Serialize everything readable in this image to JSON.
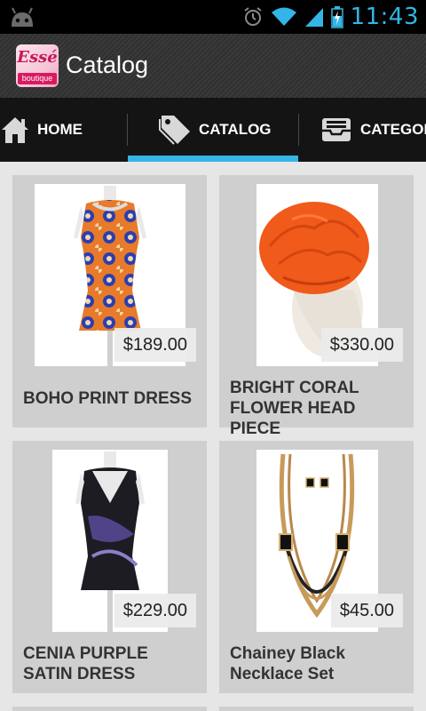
{
  "status_bar": {
    "time": "11:43",
    "icons": [
      "android-icon",
      "alarm-icon",
      "wifi-icon",
      "signal-icon",
      "battery-charging-icon"
    ],
    "accent": "#33b5e5"
  },
  "action_bar": {
    "title": "Catalog",
    "logo": {
      "top_text": "Essé",
      "bottom_text": "boutique"
    }
  },
  "tabs": [
    {
      "label": "HOME",
      "icon": "house-icon",
      "selected": false
    },
    {
      "label": "CATALOG",
      "icon": "tag-icon",
      "selected": true
    },
    {
      "label": "CATEGOR",
      "icon": "inbox-tray-icon",
      "selected": false
    }
  ],
  "products": [
    {
      "name": "BOHO PRINT DRESS",
      "price": "$189.00"
    },
    {
      "name": "BRIGHT CORAL FLOWER HEAD PIECE",
      "price": "$330.00"
    },
    {
      "name": "CENIA PURPLE SATIN DRESS",
      "price": "$229.00"
    },
    {
      "name": "Chainey Black Necklace Set",
      "price": "$45.00"
    }
  ]
}
